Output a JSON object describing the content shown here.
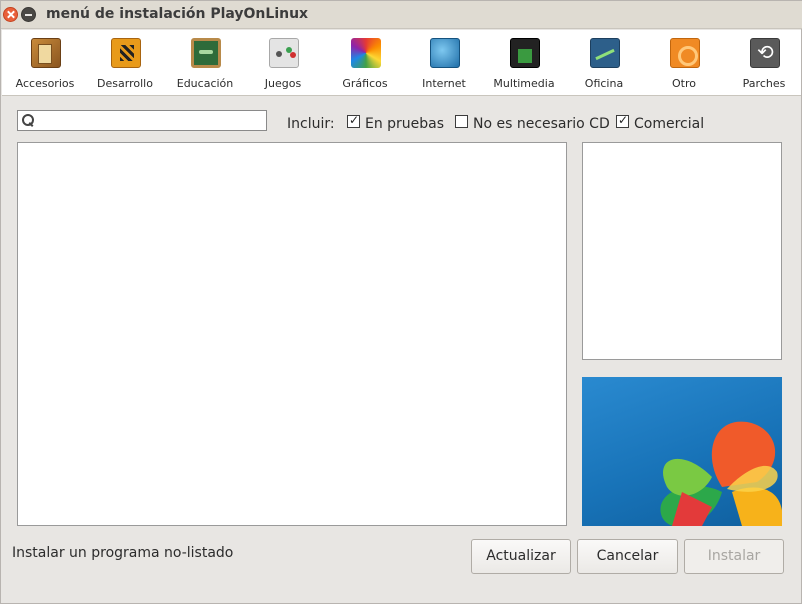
{
  "window": {
    "title": "menú de instalación PlayOnLinux"
  },
  "categories": [
    {
      "label": "Accesorios",
      "icon": "accessories-icon"
    },
    {
      "label": "Desarrollo",
      "icon": "development-icon"
    },
    {
      "label": "Educación",
      "icon": "education-icon"
    },
    {
      "label": "Juegos",
      "icon": "games-icon"
    },
    {
      "label": "Gráficos",
      "icon": "graphics-icon"
    },
    {
      "label": "Internet",
      "icon": "internet-icon"
    },
    {
      "label": "Multimedia",
      "icon": "multimedia-icon"
    },
    {
      "label": "Oficina",
      "icon": "office-icon"
    },
    {
      "label": "Otro",
      "icon": "other-icon"
    },
    {
      "label": "Parches",
      "icon": "patches-icon"
    }
  ],
  "filters": {
    "search_value": "",
    "include_label": "Incluir:",
    "testing": {
      "label": "En pruebas",
      "checked": true
    },
    "no_cd": {
      "label": "No es necesario CD",
      "checked": false
    },
    "commercial": {
      "label": "Comercial",
      "checked": true
    }
  },
  "bottom": {
    "unlisted_link": "Instalar un programa no-listado",
    "refresh_button": "Actualizar",
    "cancel_button": "Cancelar",
    "install_button": "Instalar",
    "install_disabled": true
  },
  "colors": {
    "accent_close": "#e9603a",
    "banner_blue": "#1873b8"
  }
}
